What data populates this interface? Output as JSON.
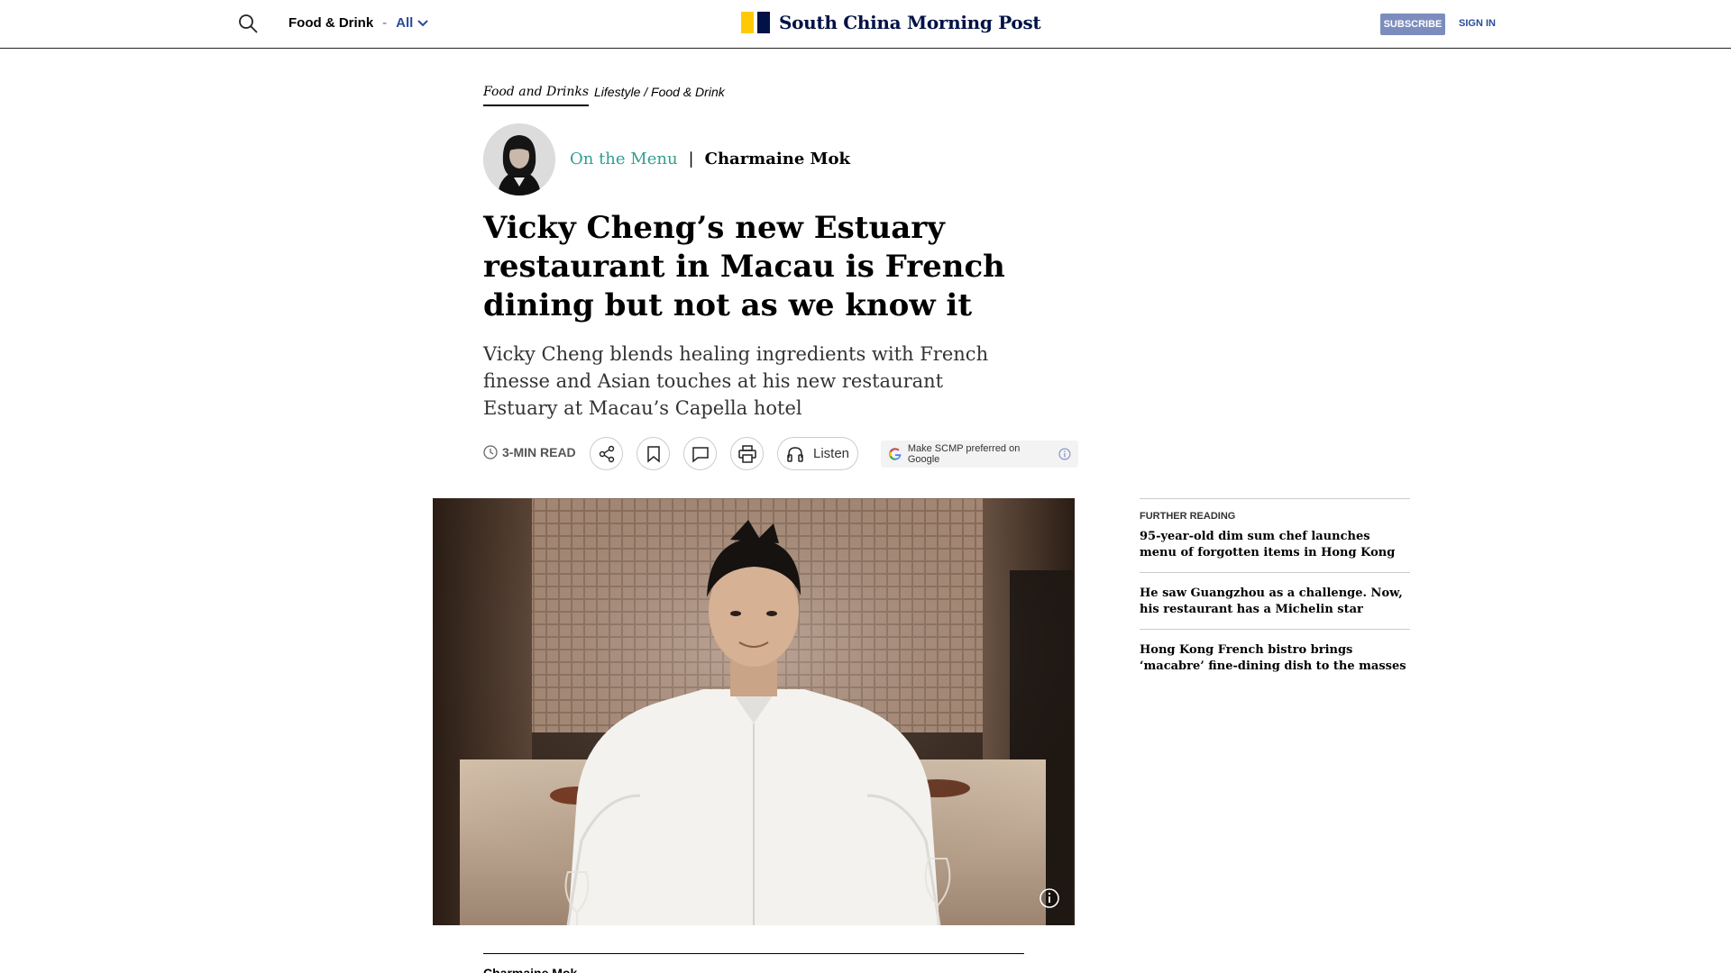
{
  "header": {
    "section": "Food & Drink",
    "separator": "-",
    "filter_label": "All",
    "logo_text": "South China Morning Post",
    "subscribe_label": "SUBSCRIBE",
    "signin_label": "SIGN IN",
    "icons": [
      "search-icon",
      "chevron-down-icon"
    ],
    "colors": {
      "brand_navy": "#001246",
      "brand_yellow": "#ffca05",
      "link_blue": "#2b4a9b",
      "subscribe_bg": "#7c8dbd"
    }
  },
  "breadcrumb": {
    "primary": "Food and Drinks",
    "secondary": "Lifestyle / Food & Drink"
  },
  "author": {
    "column": "On the Menu",
    "separator": "|",
    "name": "Charmaine Mok",
    "column_color": "#2f9f8f"
  },
  "article": {
    "headline": "Vicky Cheng’s new Estuary restaurant in Macau is French dining but not as we know it",
    "summary": "Vicky Cheng blends healing ingredients with French finesse and Asian touches at his new restaurant Estuary at Macau’s Capella hotel",
    "byline_partial": "Charmaine Mok"
  },
  "actions": {
    "read_time": "3-MIN READ",
    "listen_label": "Listen",
    "google_pref_label": "Make SCMP preferred on Google",
    "icons": [
      "clock-icon",
      "share-icon",
      "bookmark-icon",
      "comment-icon",
      "print-icon",
      "headphones-icon",
      "google-icon",
      "info-icon"
    ]
  },
  "further_reading": {
    "title": "FURTHER READING",
    "items": [
      "95-year-old dim sum chef launches menu of forgotten items in Hong Kong",
      "He saw Guangzhou as a challenge. Now, his restaurant has a Michelin star",
      "Hong Kong French bistro brings ‘macabre’ fine-dining dish to the masses"
    ]
  }
}
